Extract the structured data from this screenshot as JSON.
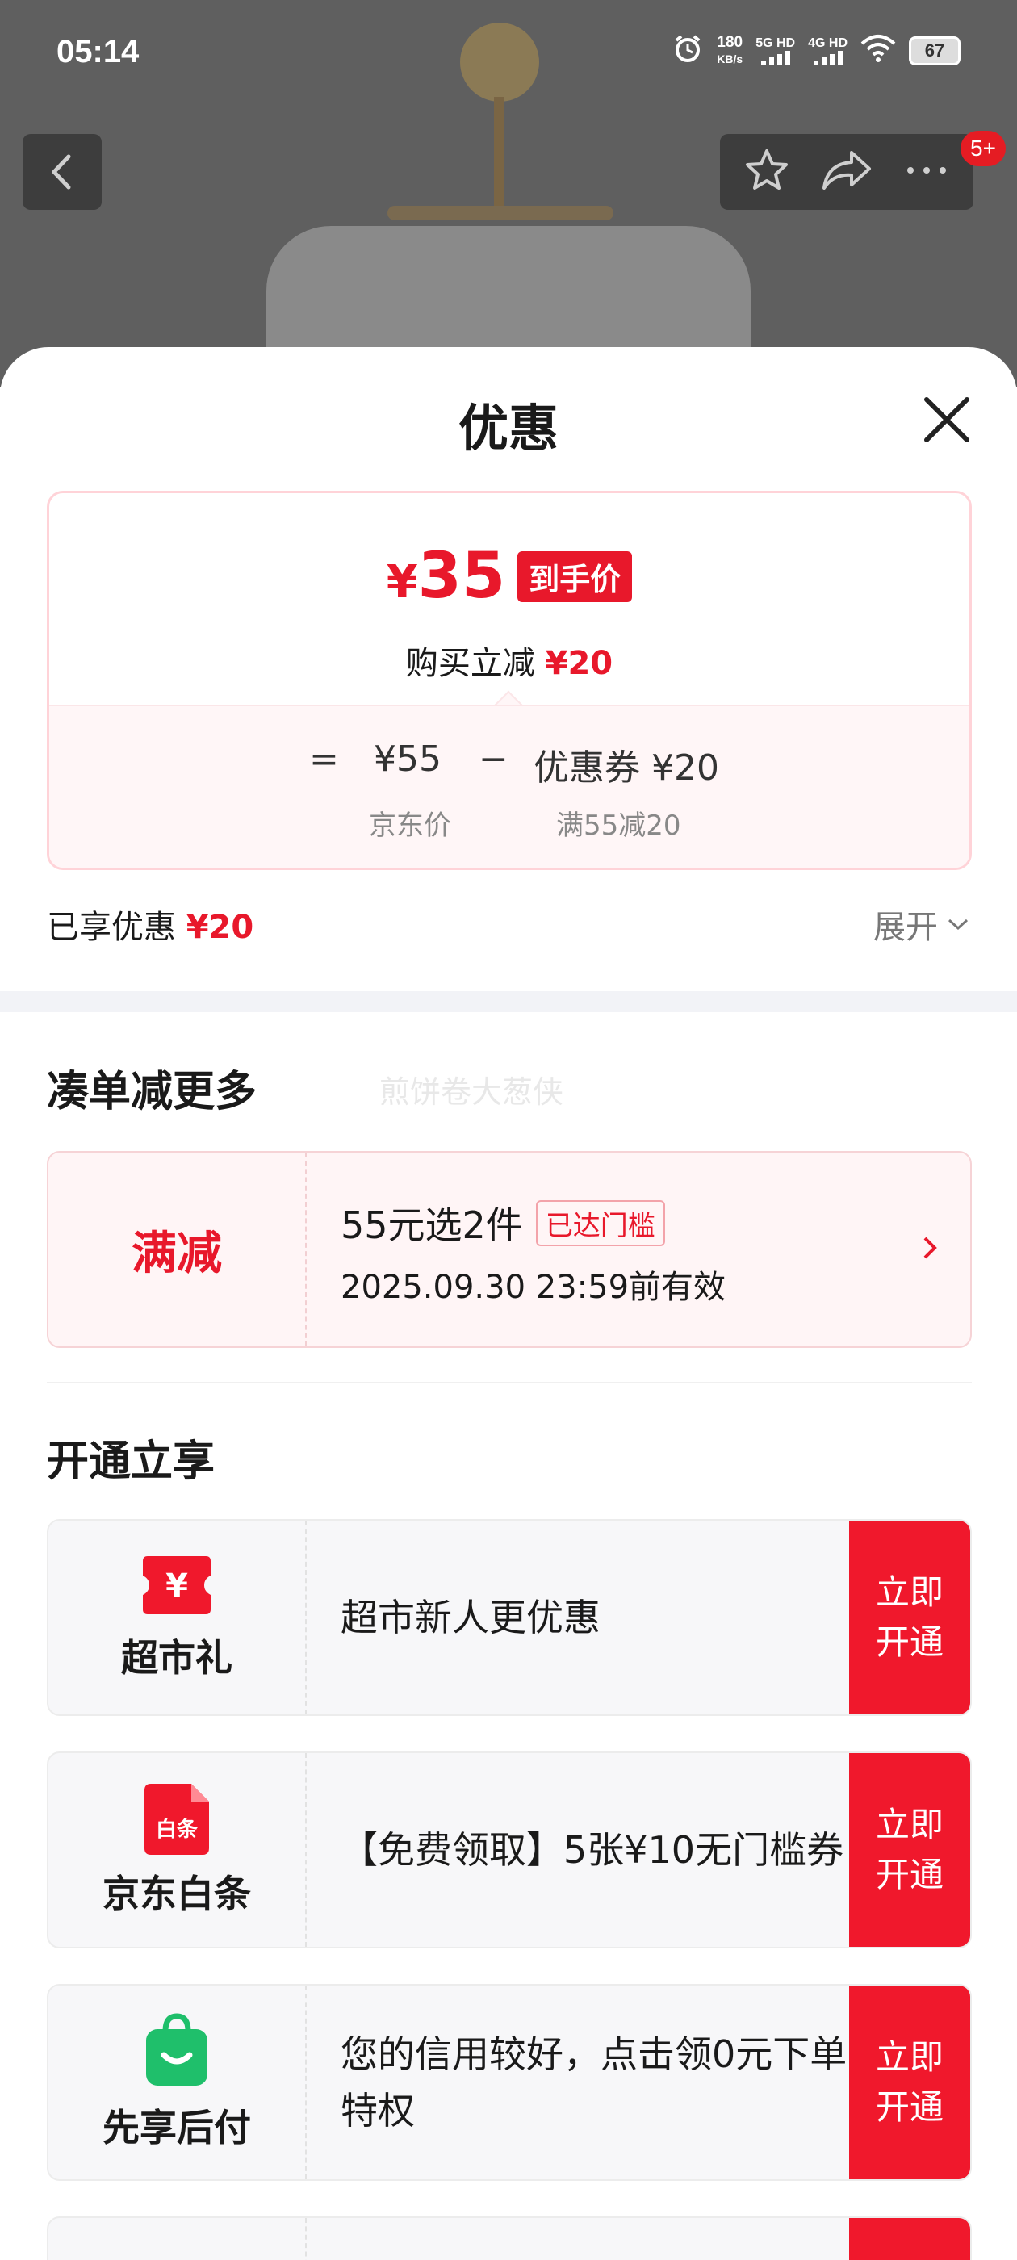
{
  "status_bar": {
    "time": "05:14",
    "net_speed_value": "180",
    "net_speed_unit": "KB/s",
    "sim1": "5G HD",
    "sim2": "4G HD",
    "battery": "67"
  },
  "top_nav": {
    "badge": "5+"
  },
  "sheet": {
    "title": "优惠",
    "final_price": "35",
    "currency": "¥",
    "price_tag": "到手价",
    "reduce_prefix": "购买立减",
    "reduce_amount": "¥20",
    "formula": {
      "equals": "=",
      "jd_price": "¥55",
      "minus": "−",
      "coupon": "优惠券 ¥20",
      "jd_price_label": "京东价",
      "coupon_label": "满55减20"
    },
    "enjoyed_label": "已享优惠",
    "enjoyed_amount": "¥20",
    "expand_label": "展开"
  },
  "bundle": {
    "title": "凑单减更多",
    "watermark": "煎饼卷大葱侠",
    "promo": {
      "type": "满减",
      "title": "55元选2件",
      "badge": "已达门槛",
      "valid": "2025.09.30 23:59前有效"
    }
  },
  "open_section": {
    "title": "开通立享",
    "items": [
      {
        "name": "超市礼",
        "icon": "supermarket-yen-ticket-icon",
        "text": "超市新人更优惠",
        "button": "立即开通"
      },
      {
        "name": "京东白条",
        "icon": "baitiao-icon",
        "icon_text": "白条",
        "text": "【免费领取】5张¥10无门槛券",
        "button": "立即开通"
      },
      {
        "name": "先享后付",
        "icon": "shopping-bag-icon",
        "text": "您的信用较好，点击领0元下单特权",
        "button": "立即开通"
      }
    ]
  },
  "colors": {
    "accent": "#e8182b",
    "button": "#f0182c",
    "pay_later": "#1fbf6b"
  }
}
